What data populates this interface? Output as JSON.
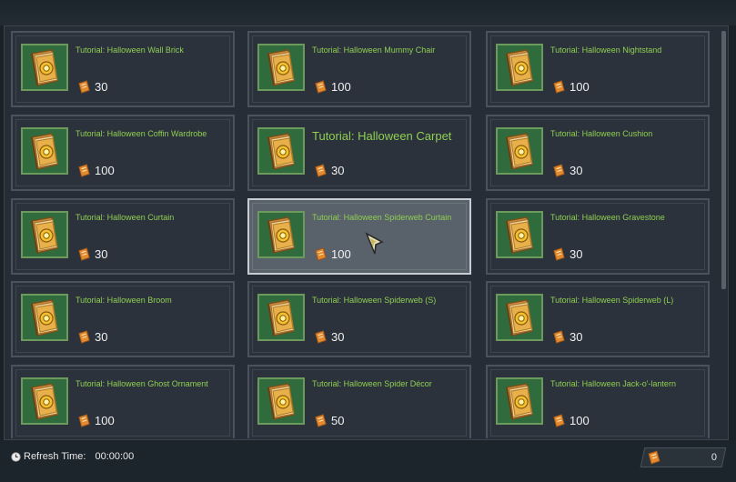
{
  "items": [
    {
      "name": "Tutorial: Halloween Wall Brick",
      "price": "30"
    },
    {
      "name": "Tutorial: Halloween Mummy Chair",
      "price": "100"
    },
    {
      "name": "Tutorial: Halloween Nightstand",
      "price": "100"
    },
    {
      "name": "Tutorial: Halloween Coffin Wardrobe",
      "price": "100"
    },
    {
      "name": "Tutorial: Halloween Carpet",
      "price": "30"
    },
    {
      "name": "Tutorial: Halloween Cushion",
      "price": "30"
    },
    {
      "name": "Tutorial: Halloween Curtain",
      "price": "30"
    },
    {
      "name": "Tutorial: Halloween Spiderweb Curtain",
      "price": "100"
    },
    {
      "name": "Tutorial: Halloween Gravestone",
      "price": "30"
    },
    {
      "name": "Tutorial: Halloween Broom",
      "price": "30"
    },
    {
      "name": "Tutorial: Halloween Spiderweb (S)",
      "price": "30"
    },
    {
      "name": "Tutorial: Halloween Spiderweb (L)",
      "price": "30"
    },
    {
      "name": "Tutorial: Halloween Ghost Ornament",
      "price": "100"
    },
    {
      "name": "Tutorial: Halloween Spider Décor",
      "price": "50"
    },
    {
      "name": "Tutorial: Halloween Jack-o'-lantern",
      "price": "100"
    }
  ],
  "footer": {
    "refresh_label": "Refresh Time:",
    "refresh_time": "00:00:00",
    "currency_value": "0"
  },
  "colors": {
    "title_green": "#8fcf52",
    "icon_bg": "#2f6b3c",
    "ticket_orange": "#e38a2e"
  }
}
